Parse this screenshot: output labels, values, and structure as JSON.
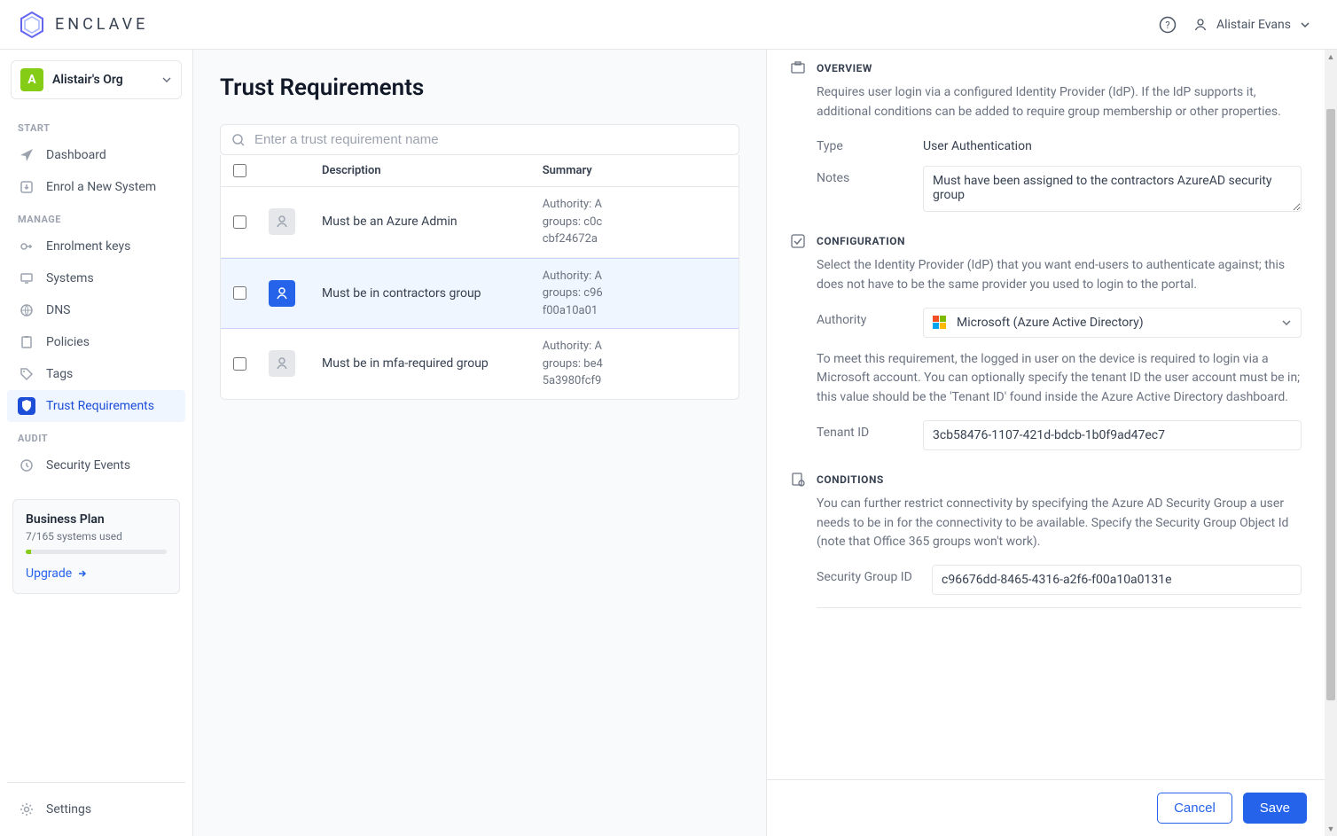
{
  "brand": "ENCLAVE",
  "user": {
    "name": "Alistair Evans"
  },
  "org": {
    "initial": "A",
    "name": "Alistair's Org"
  },
  "sidebar": {
    "sections": {
      "start": "START",
      "manage": "MANAGE",
      "audit": "AUDIT"
    },
    "items": {
      "dashboard": "Dashboard",
      "enrol": "Enrol a New System",
      "enrolment_keys": "Enrolment keys",
      "systems": "Systems",
      "dns": "DNS",
      "policies": "Policies",
      "tags": "Tags",
      "trust": "Trust Requirements",
      "security_events": "Security Events",
      "settings": "Settings"
    }
  },
  "plan": {
    "title": "Business Plan",
    "sub": "7/165 systems used",
    "upgrade": "Upgrade"
  },
  "page": {
    "title": "Trust Requirements",
    "search_placeholder": "Enter a trust requirement name",
    "columns": {
      "description": "Description",
      "summary": "Summary"
    },
    "rows": [
      {
        "desc": "Must be an Azure Admin",
        "summary": "Authority: A\ngroups: c0c\ncbf24672a"
      },
      {
        "desc": "Must be in contractors group",
        "summary": "Authority: A\ngroups: c96\nf00a10a01"
      },
      {
        "desc": "Must be in mfa-required group",
        "summary": "Authority: A\ngroups: be4\n5a3980fcf9"
      }
    ]
  },
  "detail": {
    "overview": {
      "title": "OVERVIEW",
      "desc": "Requires user login via a configured Identity Provider (IdP). If the IdP supports it, additional conditions can be added to require group membership or other properties.",
      "type_label": "Type",
      "type_value": "User Authentication",
      "notes_label": "Notes",
      "notes_value": "Must have been assigned to the contractors AzureAD security group"
    },
    "config": {
      "title": "CONFIGURATION",
      "desc": "Select the Identity Provider (IdP) that you want end-users to authenticate against; this does not have to be the same provider you used to login to the portal.",
      "authority_label": "Authority",
      "authority_value": "Microsoft (Azure Active Directory)",
      "help": "To meet this requirement, the logged in user on the device is required to login via a Microsoft account. You can optionally specify the tenant ID the user account must be in; this value should be the 'Tenant ID' found inside the Azure Active Directory dashboard.",
      "tenant_label": "Tenant ID",
      "tenant_value": "3cb58476-1107-421d-bdcb-1b0f9ad47ec7"
    },
    "conditions": {
      "title": "CONDITIONS",
      "desc": "You can further restrict connectivity by specifying the Azure AD Security Group a user needs to be in for the connectivity to be available. Specify the Security Group Object Id (note that Office 365 groups won't work).",
      "group_label": "Security Group ID",
      "group_value": "c96676dd-8465-4316-a2f6-f00a10a0131e"
    },
    "buttons": {
      "cancel": "Cancel",
      "save": "Save"
    }
  }
}
